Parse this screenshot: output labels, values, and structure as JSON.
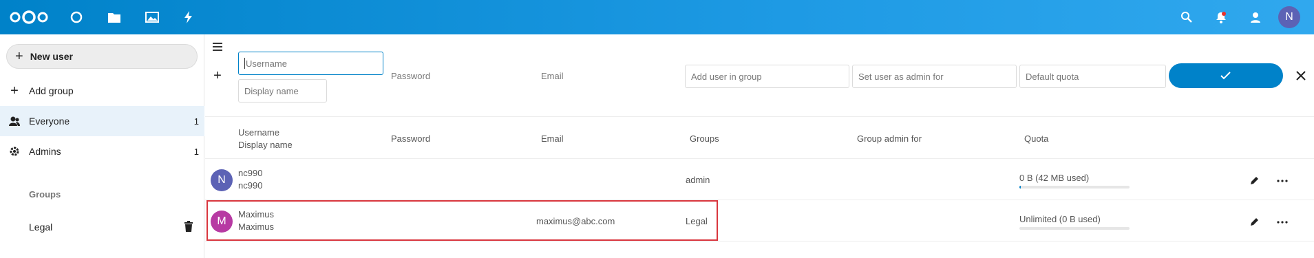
{
  "header": {
    "nav_icons": [
      "nextcloud-logo-icon",
      "dashboard-icon",
      "files-icon",
      "photos-icon",
      "activity-icon"
    ],
    "right_icons": [
      "search-icon",
      "notifications-icon",
      "contacts-icon"
    ],
    "avatar_letter": "N",
    "accent": "#0082c9"
  },
  "sidebar": {
    "new_user_label": "New user",
    "add_group_label": "Add group",
    "items": [
      {
        "label": "Everyone",
        "count": "1",
        "icon": "users-icon"
      },
      {
        "label": "Admins",
        "count": "1",
        "icon": "admin-gear-icon"
      }
    ],
    "groups_caption": "Groups",
    "groups": [
      {
        "label": "Legal",
        "icon": "trash-icon"
      }
    ]
  },
  "new_user_form": {
    "username_placeholder": "Username",
    "display_name_placeholder": "Display name",
    "password_label": "Password",
    "email_label": "Email",
    "add_group_placeholder": "Add user in group",
    "admin_for_placeholder": "Set user as admin for",
    "quota_placeholder": "Default quota"
  },
  "columns": {
    "username": "Username",
    "display_name": "Display name",
    "password": "Password",
    "email": "Email",
    "groups": "Groups",
    "group_admin": "Group admin for",
    "quota": "Quota"
  },
  "users": [
    {
      "avatar": "N",
      "avatar_color": "#5c62b5",
      "username": "nc990",
      "display_name": "nc990",
      "email": "",
      "groups": "admin",
      "quota": "0 B (42 MB used)",
      "quota_fill": 0.01
    },
    {
      "avatar": "M",
      "avatar_color": "#b73aa3",
      "username": "Maximus",
      "display_name": "Maximus",
      "email": "maximus@abc.com",
      "groups": "Legal",
      "quota": "Unlimited (0 B used)",
      "quota_fill": 0.0
    }
  ]
}
